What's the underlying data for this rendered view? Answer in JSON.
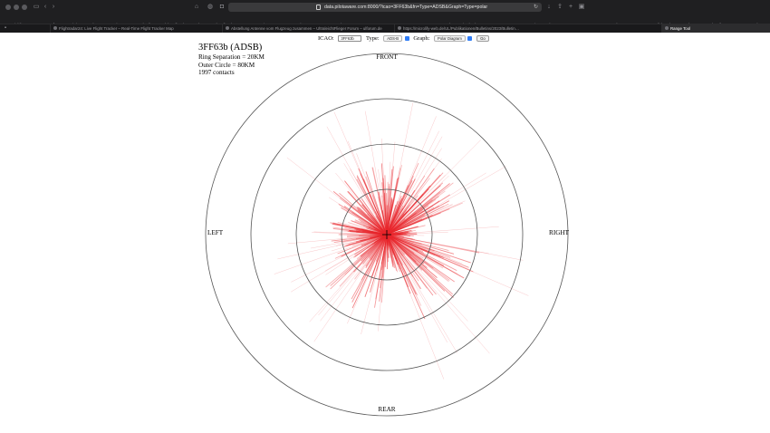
{
  "browser": {
    "address": "data.pilotaware.com:8000/?icao=3FF63b&fn=Type=ADSB&Graph=Type=polar",
    "bookmarks": [
      "EG",
      "iSkii",
      "current",
      "meteo france",
      "Aviation Formulary V1.46",
      "Finance",
      "www.plusdi.com",
      "Flybot.dk – Il… Scrapbaton",
      "sebmail",
      "dcs",
      "autorouter",
      "Piper PA-18–11TC–Mod.com",
      "LP-Test",
      "Ameshyou",
      "TT Peter Furrer",
      "TRAXX X892F – 2 DM Parts",
      "test cost kostenwien.html",
      "BD",
      "MODSBT",
      "www.paraterrainwetter.de",
      "SIM TEAM",
      "GIEP Parts & D…tor Elevator",
      "WC YOURI",
      "Flightradar24 – Tracker Map",
      "Webmail",
      "Restaurant",
      "Weather ✱ Fre…estuber.html"
    ],
    "tabs": [
      {
        "label": "Flightradar24: Live Flight Tracker – Real-Time Flight Tracker Map",
        "active": false
      },
      {
        "label": "Abstellung Antenne vom Flugzeug zusammen – UltraleichtFlieger Forum – ulforum.de",
        "active": false
      },
      {
        "label": "https://microlify-web.de/UL/Publikationen/Bulletins/2023/Bulletin…",
        "active": false
      },
      {
        "label": "Range Tool",
        "active": true
      }
    ]
  },
  "form": {
    "icao_label": "ICAO:",
    "icao_value": "3FF63b",
    "type_label": "Type:",
    "type_value": "ADS-B",
    "graph_label": "Graph:",
    "graph_value": "Polar Diagram",
    "go_label": "Go"
  },
  "info": {
    "title": "3FF63b (ADSB)",
    "ring_separation": "Ring Separation = 20KM",
    "outer_circle": "Outer Circle = 80KM",
    "contacts": "1997 contacts"
  },
  "polar": {
    "directions": {
      "front": "FRONT",
      "right": "RIGHT",
      "rear": "REAR",
      "left": "LEFT"
    },
    "ring_separation_km": 20,
    "outer_circle_km": 80,
    "ring_color": "#555555",
    "line_color": "#e8252b"
  }
}
